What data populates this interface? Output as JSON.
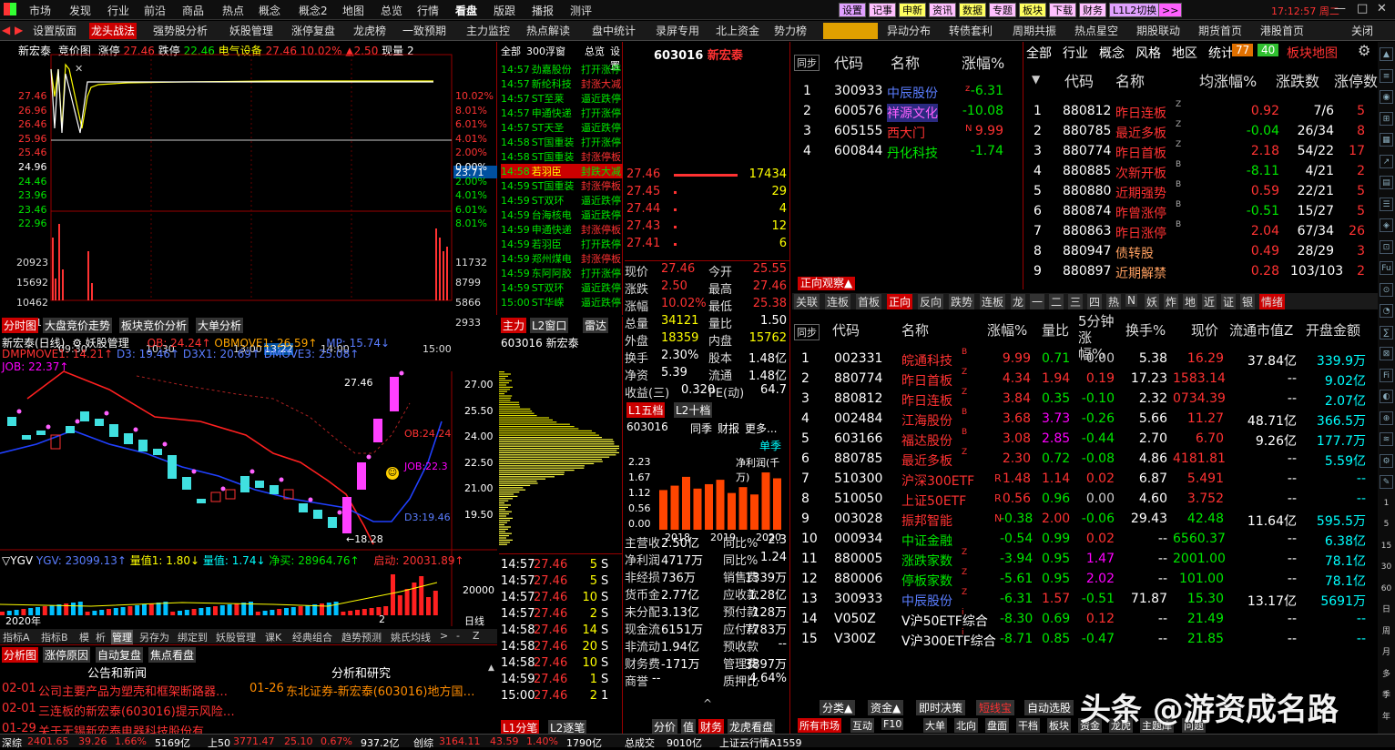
{
  "menu": {
    "items": [
      "市场",
      "发现",
      "行业",
      "前沿",
      "商品",
      "热点",
      "概念",
      "概念2",
      "地图",
      "总览",
      "行情",
      "看盘",
      "版跟",
      "播报",
      "测评"
    ],
    "tools": [
      {
        "t": "设置",
        "c": "#e0a0ff"
      },
      {
        "t": "记事",
        "c": "#ffc0ff"
      },
      {
        "t": "申新",
        "c": "#ffff60"
      },
      {
        "t": "资讯",
        "c": "#ffc0ff"
      },
      {
        "t": "数据",
        "c": "#ffff60"
      },
      {
        "t": "专题",
        "c": "#ffc0ff"
      },
      {
        "t": "板块",
        "c": "#ffff60"
      },
      {
        "t": "下载",
        "c": "#ffc0ff"
      },
      {
        "t": "财务",
        "c": "#ffc0ff"
      },
      {
        "t": "L1L2切换",
        "c": "#e0a0ff"
      },
      {
        "t": ">>",
        "c": "#ff60ff"
      }
    ],
    "clock": "17:12:57 周二"
  },
  "tabs": [
    "设置版面",
    "龙头战法",
    "强势股分析",
    "妖股管理",
    "涨停复盘",
    "龙虎榜",
    "一致预期",
    "主力监控",
    "热点解读",
    "盘中统计",
    "录屏专用",
    "北上资金",
    "势力榜",
    "",
    "异动分布",
    "转债套利",
    "周期共振",
    "热点星空",
    "期股联动",
    "期货首页",
    "港股首页",
    "关闭"
  ],
  "intraday": {
    "header": {
      "name": "新宏泰",
      "mode": "竞价图",
      "zt_label": "涨停",
      "zt": "27.46",
      "dt_label": "跌停",
      "dt": "22.46",
      "sector": "电气设备",
      "price": "27.46",
      "pct": "10.02%",
      "chg": "▲2.50",
      "vol_label": "现量",
      "vol": "2"
    },
    "price_ticks": [
      "27.46",
      "26.96",
      "26.46",
      "25.96",
      "25.46",
      "24.96",
      "24.46",
      "23.96",
      "23.46",
      "22.96"
    ],
    "pct_ticks": [
      "10.02%",
      "8.01%",
      "6.01%",
      "4.01%",
      "2.00%",
      "0.00%",
      "2.00%",
      "4.01%",
      "6.01%",
      "8.01%"
    ],
    "vol_ticks_left": [
      "20923",
      "15692",
      "10462",
      "5231"
    ],
    "vol_ticks_right": [
      "11732",
      "8799",
      "5866",
      "2933"
    ],
    "time_ticks": [
      "09:30",
      "10:30",
      "13:00",
      "13:22",
      "14:00",
      "15:00"
    ],
    "cross_price": "23.71"
  },
  "tape": {
    "tabs": [
      "全部",
      "300浮窗",
      "总览",
      "设置"
    ],
    "rows": [
      [
        "14:57",
        "劲嘉股份",
        "打开涨停"
      ],
      [
        "14:57",
        "新纶科技",
        "封涨大减"
      ],
      [
        "14:57",
        "ST至莱",
        "逼近跌停"
      ],
      [
        "14:57",
        "申通快递",
        "打开涨停"
      ],
      [
        "14:57",
        "ST天圣",
        "逼近跌停"
      ],
      [
        "14:58",
        "ST国重装",
        "打开涨停"
      ],
      [
        "14:58",
        "ST国重装",
        "封涨停板"
      ],
      [
        "14:58",
        "若羽臣",
        "封跌大减"
      ],
      [
        "14:59",
        "ST国重装",
        "封涨停板"
      ],
      [
        "14:59",
        "ST双环",
        "逼近跌停"
      ],
      [
        "14:59",
        "台海核电",
        "逼近跌停"
      ],
      [
        "14:59",
        "申通快递",
        "封涨停板"
      ],
      [
        "14:59",
        "若羽臣",
        "打开跌停"
      ],
      [
        "14:59",
        "郑州煤电",
        "封涨停板"
      ],
      [
        "14:59",
        "东阿阿胶",
        "打开涨停"
      ],
      [
        "14:59",
        "ST双环",
        "逼近跌停"
      ],
      [
        "15:00",
        "ST华嵘",
        "逼近跌停"
      ]
    ]
  },
  "quote": {
    "code": "603016",
    "name": "新宏泰",
    "sells": [
      [
        "27.46",
        "17434"
      ],
      [
        "27.45",
        "29"
      ],
      [
        "27.44",
        "4"
      ],
      [
        "27.43",
        "12"
      ],
      [
        "27.41",
        "6"
      ]
    ],
    "stats": [
      [
        "现价",
        "27.46",
        "今开",
        "25.55"
      ],
      [
        "涨跌",
        "2.50",
        "最高",
        "27.46"
      ],
      [
        "涨幅",
        "10.02%",
        "最低",
        "25.38"
      ],
      [
        "总量",
        "34121",
        "量比",
        "1.50"
      ],
      [
        "外盘",
        "18359",
        "内盘",
        "15762"
      ],
      [
        "换手",
        "2.30%",
        "股本",
        "1.48亿"
      ],
      [
        "净资",
        "5.39",
        "流通",
        "1.48亿"
      ],
      [
        "收益(三)",
        "0.320",
        "PE(动)",
        "64.7"
      ]
    ],
    "l1tabs": [
      "L1五档",
      "L2十档"
    ],
    "fin_tabs": [
      "603016",
      "同季",
      "财报",
      "更多..."
    ],
    "season": "单季",
    "profit_label": "净利润(千万)",
    "fin_yticks": [
      "2.23",
      "1.67",
      "1.12",
      "0.56",
      "0.00"
    ],
    "fin_xticks": [
      "2018",
      "2019",
      "2020"
    ],
    "fin": [
      [
        "主营收",
        "2.50亿",
        "同比%",
        "-2.3"
      ],
      [
        "净利润",
        "4717万",
        "同比%",
        "1.24"
      ],
      [
        "非经损",
        "736万",
        "销售费",
        "1339万"
      ],
      [
        "货币金",
        "2.77亿",
        "应收款",
        "1.28亿"
      ],
      [
        "未分配",
        "3.13亿",
        "预付款",
        "128万"
      ],
      [
        "现金流",
        "6151万",
        "应付款",
        "7783万"
      ],
      [
        "非流动",
        "1.94亿",
        "预收款",
        "--"
      ],
      [
        "财务费",
        "-171万",
        "管理费",
        "3897万"
      ],
      [
        "商誉",
        "--",
        "质押比",
        "4.64%"
      ]
    ],
    "bottom_tabs": [
      "分价",
      "值",
      "财务",
      "龙虎看盘"
    ]
  },
  "chart_data": {
    "type": "bar",
    "title": "净利润(千万)",
    "categories": [
      "2018",
      "2018",
      "2018",
      "2018",
      "2019",
      "2019",
      "2019",
      "2019",
      "2020",
      "2020",
      "2020"
    ],
    "values": [
      1.35,
      1.5,
      1.8,
      1.4,
      1.55,
      1.7,
      1.25,
      1.45,
      1.2,
      1.95,
      1.75
    ],
    "ylim": [
      0,
      2.23
    ]
  },
  "top_list": {
    "header": [
      "同步",
      "代码",
      "名称",
      "涨幅%"
    ],
    "rows": [
      [
        "1",
        "300933",
        "中辰股份",
        "z",
        "-6.31"
      ],
      [
        "2",
        "600576",
        "祥源文化",
        "",
        "-10.08"
      ],
      [
        "3",
        "605155",
        "西大门",
        "N",
        "9.99"
      ],
      [
        "4",
        "600844",
        "丹化科技",
        "",
        "-1.74"
      ]
    ],
    "watch": "正向观察▲"
  },
  "board": {
    "tabs": [
      "全部",
      "行业",
      "概念",
      "风格",
      "地区",
      "统计"
    ],
    "badge1": "77",
    "badge2": "40",
    "map": "板块地图",
    "header": [
      "代码",
      "名称",
      "均涨幅%",
      "涨跌数",
      "涨停数"
    ],
    "rows": [
      [
        "1",
        "880812",
        "昨日连板",
        "Z",
        "0.92",
        "7/6",
        "5"
      ],
      [
        "2",
        "880785",
        "最近多板",
        "Z",
        "-0.04",
        "26/34",
        "8"
      ],
      [
        "3",
        "880774",
        "昨日首板",
        "Z",
        "2.18",
        "54/22",
        "17"
      ],
      [
        "4",
        "880885",
        "次新开板",
        "B",
        "-8.11",
        "4/21",
        "2"
      ],
      [
        "5",
        "880880",
        "近期强势",
        "B",
        "0.59",
        "22/21",
        "5"
      ],
      [
        "6",
        "880874",
        "昨曾涨停",
        "B",
        "-0.51",
        "15/27",
        "5"
      ],
      [
        "7",
        "880863",
        "昨日涨停",
        "B",
        "2.04",
        "67/34",
        "26"
      ],
      [
        "8",
        "880947",
        "债转股",
        "",
        "0.49",
        "28/29",
        "3"
      ],
      [
        "9",
        "880897",
        "近期解禁",
        "",
        "0.28",
        "103/103",
        "2"
      ]
    ]
  },
  "filter_tabs": [
    "关联",
    "连板",
    "首板",
    "正向",
    "反向",
    "跌势",
    "连板",
    "龙",
    "一",
    "二",
    "三",
    "四",
    "热",
    "N",
    "妖",
    "炸",
    "地",
    "近",
    "证",
    "银",
    "情绪"
  ],
  "main_list": {
    "header": [
      "同步",
      "代码",
      "名称",
      "涨幅%",
      "量比",
      "5分钟涨幅%",
      "换手%",
      "现价",
      "流通市值Z",
      "开盘金额"
    ],
    "rows": [
      [
        "1",
        "002331",
        "皖通科技",
        "B",
        "9.99",
        "0.71",
        "0.00",
        "5.38",
        "16.29",
        "37.84亿",
        "339.9万"
      ],
      [
        "2",
        "880774",
        "昨日首板",
        "Z",
        "4.34",
        "1.94",
        "0.19",
        "17.23",
        "1583.14",
        "--",
        "9.02亿"
      ],
      [
        "3",
        "880812",
        "昨日连板",
        "Z",
        "3.84",
        "0.35",
        "-0.10",
        "2.32",
        "0734.39",
        "--",
        "2.07亿"
      ],
      [
        "4",
        "002484",
        "江海股份",
        "B",
        "3.68",
        "3.73",
        "-0.26",
        "5.66",
        "11.27",
        "48.71亿",
        "366.5万"
      ],
      [
        "5",
        "603166",
        "福达股份",
        "B",
        "3.08",
        "2.85",
        "-0.44",
        "2.70",
        "6.70",
        "9.26亿",
        "177.7万"
      ],
      [
        "6",
        "880785",
        "最近多板",
        "Z",
        "2.30",
        "0.72",
        "-0.08",
        "4.86",
        "4181.81",
        "--",
        "5.59亿"
      ],
      [
        "7",
        "510300",
        "沪深300ETF",
        "R",
        "1.48",
        "1.14",
        "0.02",
        "6.87",
        "5.491",
        "--",
        "--"
      ],
      [
        "8",
        "510050",
        "上证50ETF",
        "R",
        "0.56",
        "0.96",
        "0.00",
        "4.60",
        "3.752",
        "--",
        "--"
      ],
      [
        "9",
        "003028",
        "振邦智能",
        "N",
        "-0.38",
        "2.00",
        "-0.06",
        "29.43",
        "42.48",
        "11.64亿",
        "595.5万"
      ],
      [
        "10",
        "000934",
        "中证金融",
        "",
        "-0.54",
        "0.99",
        "0.02",
        "--",
        "6560.37",
        "--",
        "6.38亿"
      ],
      [
        "11",
        "880005",
        "涨跌家数",
        "Z",
        "-3.94",
        "0.95",
        "1.47",
        "--",
        "2001.00",
        "--",
        "78.1亿"
      ],
      [
        "12",
        "880006",
        "停板家数",
        "Z",
        "-5.61",
        "0.95",
        "2.02",
        "--",
        "101.00",
        "--",
        "78.1亿"
      ],
      [
        "13",
        "300933",
        "中辰股份",
        "Z",
        "-6.31",
        "1.57",
        "-0.51",
        "71.87",
        "15.30",
        "13.17亿",
        "5691万"
      ],
      [
        "14",
        "V050Z",
        "V沪50ETF综合",
        "i",
        "-8.30",
        "0.69",
        "0.12",
        "--",
        "21.49",
        "--",
        "--"
      ],
      [
        "15",
        "V300Z",
        "V沪300ETF综合",
        "i",
        "-8.71",
        "0.85",
        "-0.47",
        "--",
        "21.85",
        "--",
        "--"
      ]
    ],
    "bottom_tabs": [
      "分类▲",
      "资金▲",
      "即时决策",
      "短线宝",
      "自动选股"
    ],
    "bottom_tabs2": [
      "所有市场",
      "互动",
      "F10",
      "大单",
      "北向",
      "盘面",
      "干档",
      "板块",
      "资金",
      "龙虎",
      "主题库",
      "问题"
    ]
  },
  "kline": {
    "tabs": [
      "分时图",
      "大盘竞价走势",
      "板块竞价分析",
      "大单分析"
    ],
    "title": "新宏泰(日线)",
    "mode": "妖股管理",
    "ind1": "OB: 24.24↑",
    "ind2": "OBMOVE1: 26.59↑",
    "ind3": "MP: 15.74↓",
    "ind4": "DMPMOVE1: 14.21↑",
    "ind5": "D3: 19.46↑",
    "ind6": "D3X1: 20.69↑",
    "ind7": "DMOVE3: 25.08↑",
    "ind8": "JOB: 22.37↑",
    "yticks": [
      "27.00",
      "25.50",
      "24.00",
      "22.50",
      "21.00",
      "19.50"
    ],
    "high": "27.46",
    "low": "←18.28",
    "lbl_ob": "OB:24.24",
    "lbl_job": "JOB:22.3",
    "lbl_d3": "D3:19.46",
    "vol_title": "YGV",
    "vol_ind": "YGV: 23099.13↑",
    "vol_a": "量值1: 1.80↓",
    "vol_b": "量值: 1.74↓",
    "vol_c": "净买: 28964.76↑",
    "vol_d": "启动: 20031.89↑",
    "vol_ytick": "20000",
    "year": "2020年",
    "mon": "2",
    "period": "日线",
    "btabs": [
      "指标A",
      "指标B",
      "模",
      "析",
      "管理",
      "另存为",
      "绑定到",
      "妖股管理",
      "课K",
      "经典组合",
      "趋势预测",
      "姚氏均线",
      ">",
      "-",
      "Z"
    ]
  },
  "profile": {
    "tabs": [
      "主力",
      "L2窗口",
      "雷达"
    ],
    "code": "603016 新宏泰"
  },
  "ticks": {
    "rows": [
      [
        "14:57",
        "27.46",
        "5",
        "S"
      ],
      [
        "14:57",
        "27.46",
        "5",
        "S"
      ],
      [
        "14:57",
        "27.46",
        "10",
        "S"
      ],
      [
        "14:57",
        "27.46",
        "2",
        "S"
      ],
      [
        "14:58",
        "27.46",
        "14",
        "S"
      ],
      [
        "14:58",
        "27.46",
        "20",
        "S"
      ],
      [
        "14:58",
        "27.46",
        "10",
        "S"
      ],
      [
        "14:59",
        "27.46",
        "1",
        "S"
      ],
      [
        "15:00",
        "27.46",
        "2",
        "1"
      ]
    ],
    "tabs": [
      "L1分笔",
      "L2逐笔"
    ]
  },
  "news": {
    "tabs": [
      "分析图",
      "涨停原因",
      "自动复盘",
      "焦点看盘"
    ],
    "h1": "公告和新闻",
    "h2": "分析和研究",
    "items": [
      [
        "02-01",
        "公司主要产品为塑壳和框架断路器…",
        "01-26",
        "东北证券-新宏泰(603016)地方国…"
      ],
      [
        "02-01",
        "三连板的新宏泰(603016)提示风险…",
        "",
        ""
      ],
      [
        "01-29",
        "关于无锡新宏泰电器科技股份有…",
        "",
        ""
      ]
    ]
  },
  "status": {
    "items": [
      [
        "深综",
        "2401.65",
        "39.26",
        "1.66%",
        "5169亿"
      ],
      [
        "上50",
        "3771.47",
        "25.10",
        "0.67%",
        "937.2亿"
      ],
      [
        "创综",
        "3164.11",
        "43.59",
        "1.40%",
        "1790亿"
      ]
    ],
    "total_label": "总成交",
    "total": "9010亿",
    "idx": "上证云行情A1559"
  },
  "watermark": "头条 @游资成名路"
}
